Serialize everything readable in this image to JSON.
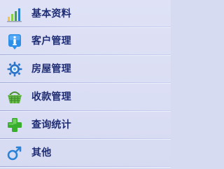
{
  "menu": {
    "items": [
      {
        "label": "基本资料",
        "icon": "bar-chart-icon"
      },
      {
        "label": "客户管理",
        "icon": "info-icon"
      },
      {
        "label": "房屋管理",
        "icon": "gear-icon"
      },
      {
        "label": "收款管理",
        "icon": "basket-icon"
      },
      {
        "label": "查询统计",
        "icon": "plus-icon"
      },
      {
        "label": "其他",
        "icon": "male-symbol-icon"
      }
    ]
  }
}
